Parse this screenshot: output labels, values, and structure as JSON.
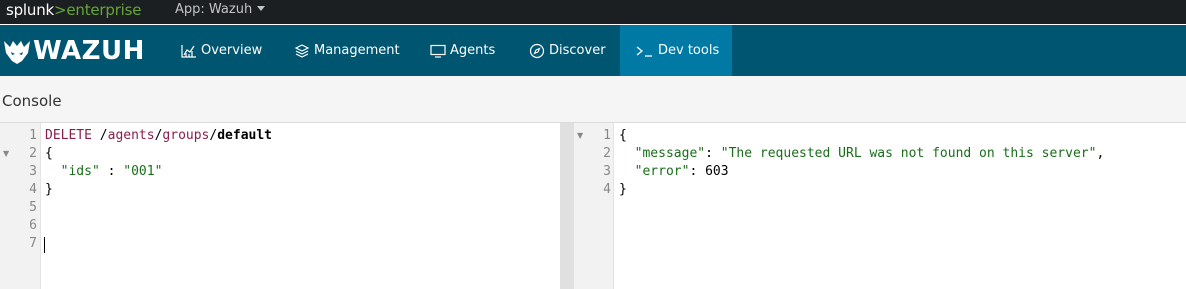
{
  "splunk": {
    "logo_part1": "splunk",
    "logo_part2": ">enterprise",
    "app_menu_label": "App: Wazuh"
  },
  "wazuh": {
    "logo_text": "WAZUH",
    "nav": [
      {
        "label": "Overview",
        "icon": "chart-icon"
      },
      {
        "label": "Management",
        "icon": "management-icon"
      },
      {
        "label": "Agents",
        "icon": "monitor-icon"
      },
      {
        "label": "Discover",
        "icon": "compass-icon"
      },
      {
        "label": "Dev tools",
        "icon": "terminal-prompt-icon",
        "active": true
      }
    ]
  },
  "console": {
    "title": "Console"
  },
  "request_editor": {
    "line_numbers": [
      "1",
      "2",
      "3",
      "4",
      "5",
      "6",
      "7"
    ],
    "line1": {
      "method": "DELETE",
      "slash1": " /",
      "seg1": "agents",
      "slash2": "/",
      "seg2": "groups",
      "slash3": "/",
      "seg3": "default"
    },
    "line2": "{",
    "line3": {
      "key": "\"ids\"",
      "sep": " : ",
      "value": "\"001\""
    },
    "line4": "}"
  },
  "response_editor": {
    "line_numbers": [
      "1",
      "2",
      "3",
      "4"
    ],
    "line1": "{",
    "line2": {
      "key": "\"message\"",
      "sep": ": ",
      "value": "\"The requested URL was not found on this server\"",
      "trail": ","
    },
    "line3": {
      "key": "\"error\"",
      "sep": ": ",
      "value": "603"
    },
    "line4": "}"
  },
  "colors": {
    "splunk_bar": "#1c1f22",
    "splunk_green": "#65a637",
    "wazuh_bar": "#005571",
    "nav_active": "#0079a5",
    "keyword": "#8b1f4a",
    "string": "#1a6e1a"
  }
}
